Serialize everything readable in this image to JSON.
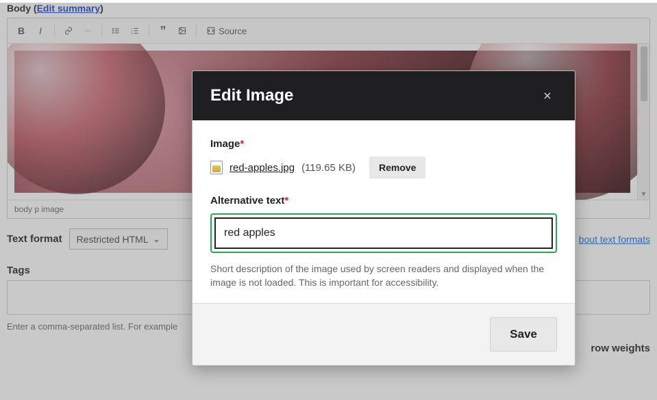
{
  "body_field": {
    "label": "Body",
    "summary_link": "Edit summary",
    "path": "body  p  image"
  },
  "toolbar": {
    "source_label": "Source"
  },
  "format": {
    "label": "Text format",
    "selected": "Restricted HTML",
    "about_link": "bout text formats"
  },
  "tags": {
    "label": "Tags",
    "value": "",
    "help": "Enter a comma-separated list. For example"
  },
  "row_weights": "row weights",
  "modal": {
    "title": "Edit Image",
    "image_label": "Image",
    "file_name": "red-apples.jpg",
    "file_size": "(119.65 KB)",
    "remove_label": "Remove",
    "alt_label": "Alternative text",
    "alt_value": "red apples",
    "alt_help": "Short description of the image used by screen readers and displayed when the image is not loaded. This is important for accessibility.",
    "save_label": "Save"
  }
}
